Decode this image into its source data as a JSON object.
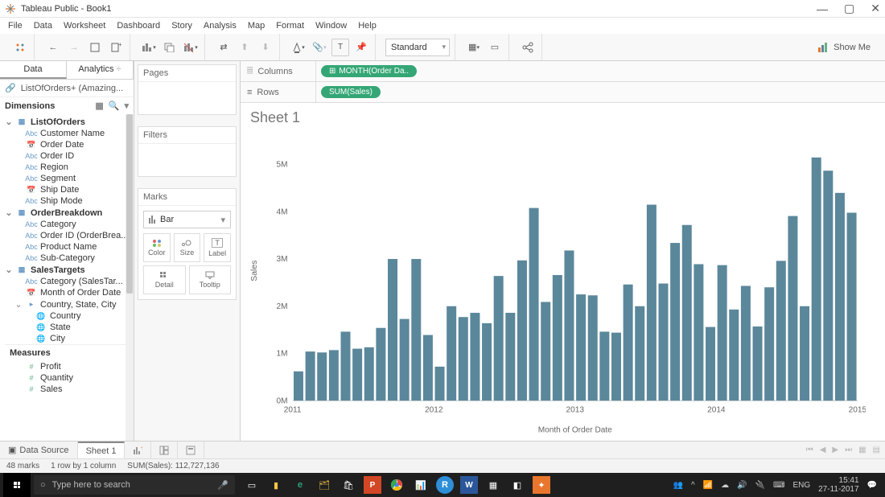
{
  "app": {
    "title": "Tableau Public - Book1"
  },
  "menubar": [
    "File",
    "Data",
    "Worksheet",
    "Dashboard",
    "Story",
    "Analysis",
    "Map",
    "Format",
    "Window",
    "Help"
  ],
  "toolbar": {
    "fit": "Standard",
    "showme": "Show Me"
  },
  "sidebar": {
    "tabs": [
      "Data",
      "Analytics"
    ],
    "datasource": "ListOfOrders+ (Amazing...",
    "dimensions_label": "Dimensions",
    "measures_label": "Measures",
    "groups": [
      {
        "name": "ListOfOrders",
        "open": true,
        "items": [
          {
            "icon": "abc",
            "label": "Customer Name"
          },
          {
            "icon": "date",
            "label": "Order Date"
          },
          {
            "icon": "abc",
            "label": "Order ID"
          },
          {
            "icon": "abc",
            "label": "Region"
          },
          {
            "icon": "abc",
            "label": "Segment"
          },
          {
            "icon": "date",
            "label": "Ship Date"
          },
          {
            "icon": "abc",
            "label": "Ship Mode"
          }
        ]
      },
      {
        "name": "OrderBreakdown",
        "open": true,
        "items": [
          {
            "icon": "abc",
            "label": "Category"
          },
          {
            "icon": "abc",
            "label": "Order ID (OrderBrea..."
          },
          {
            "icon": "abc",
            "label": "Product Name"
          },
          {
            "icon": "abc",
            "label": "Sub-Category"
          }
        ]
      },
      {
        "name": "SalesTargets",
        "open": true,
        "items": [
          {
            "icon": "abc",
            "label": "Category (SalesTar..."
          },
          {
            "icon": "date",
            "label": "Month of Order Date"
          },
          {
            "icon": "geo",
            "label": "Country, State, City",
            "sub": [
              {
                "icon": "globe",
                "label": "Country"
              },
              {
                "icon": "globe",
                "label": "State"
              },
              {
                "icon": "globe",
                "label": "City"
              }
            ]
          }
        ]
      }
    ],
    "measures": [
      {
        "icon": "num",
        "label": "Profit"
      },
      {
        "icon": "num",
        "label": "Quantity"
      },
      {
        "icon": "num",
        "label": "Sales"
      }
    ]
  },
  "shelves": {
    "pages": "Pages",
    "filters": "Filters",
    "marks": "Marks",
    "mark_type": "Bar",
    "mark_cards": [
      "Color",
      "Size",
      "Label",
      "Detail",
      "Tooltip"
    ]
  },
  "cols_rows": {
    "columns_label": "Columns",
    "rows_label": "Rows",
    "col_pill": "MONTH(Order Da..",
    "row_pill": "SUM(Sales)"
  },
  "sheet": {
    "title": "Sheet 1"
  },
  "chart_data": {
    "type": "bar",
    "ylabel": "Sales",
    "xlabel": "Month of Order Date",
    "ylim": [
      0,
      5500000
    ],
    "yticks": [
      0,
      1000000,
      2000000,
      3000000,
      4000000,
      5000000
    ],
    "ytick_labels": [
      "0M",
      "1M",
      "2M",
      "3M",
      "4M",
      "5M"
    ],
    "xticks": [
      "2011",
      "2012",
      "2013",
      "2014",
      "2015"
    ],
    "values": [
      620000,
      1040000,
      1020000,
      1070000,
      1460000,
      1100000,
      1130000,
      1540000,
      3000000,
      1730000,
      3000000,
      1390000,
      720000,
      2000000,
      1770000,
      1860000,
      1640000,
      2640000,
      1860000,
      2970000,
      4080000,
      2090000,
      2660000,
      3180000,
      2250000,
      2230000,
      1460000,
      1440000,
      2460000,
      2000000,
      4150000,
      2480000,
      3340000,
      3720000,
      2890000,
      1560000,
      2870000,
      1930000,
      2430000,
      1570000,
      2400000,
      2960000,
      3910000,
      2000000,
      5150000,
      4870000,
      4400000,
      3980000
    ]
  },
  "tabs": {
    "datasource": "Data Source",
    "sheet1": "Sheet 1"
  },
  "status": {
    "marks": "48 marks",
    "rowcol": "1 row by 1 column",
    "sum": "SUM(Sales): 112,727,136"
  },
  "taskbar": {
    "search_placeholder": "Type here to search",
    "lang": "ENG",
    "time": "15:41",
    "date": "27-11-2017"
  }
}
